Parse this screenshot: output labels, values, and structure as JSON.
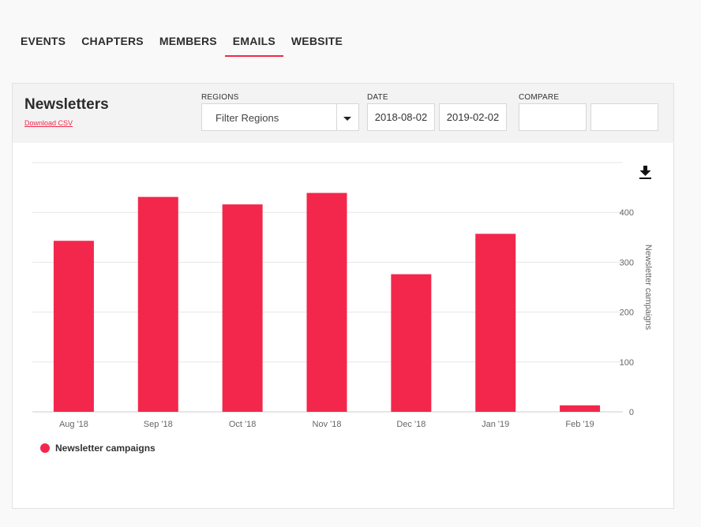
{
  "nav": {
    "tabs": [
      {
        "label": "EVENTS"
      },
      {
        "label": "CHAPTERS"
      },
      {
        "label": "MEMBERS"
      },
      {
        "label": "EMAILS"
      },
      {
        "label": "WEBSITE"
      }
    ],
    "active": "EMAILS"
  },
  "panel": {
    "title": "Newsletters",
    "download_csv": "Download CSV",
    "regions_label": "REGIONS",
    "regions_placeholder": "Filter Regions",
    "date_label": "DATE",
    "date_from": "2018-08-02",
    "date_to": "2019-02-02",
    "compare_label": "COMPARE",
    "compare_from": "",
    "compare_to": ""
  },
  "icons": {
    "download": "download-icon",
    "dropdown": "chevron-down-icon"
  },
  "colors": {
    "accent": "#f3274b",
    "grid": "#e6e6e6",
    "axis_text": "#666666"
  },
  "chart_data": {
    "type": "bar",
    "categories": [
      "Aug '18",
      "Sep '18",
      "Oct '18",
      "Nov '18",
      "Dec '18",
      "Jan '19",
      "Feb '19"
    ],
    "series": [
      {
        "name": "Newsletter campaigns",
        "values": [
          343,
          431,
          416,
          439,
          276,
          357,
          13
        ]
      }
    ],
    "ylabel": "Newsletter campaigns",
    "ylim": [
      0,
      500
    ],
    "yticks": [
      0,
      100,
      200,
      300,
      400
    ],
    "y_axis_side": "right",
    "grid": true,
    "legend": "bottom-left"
  }
}
